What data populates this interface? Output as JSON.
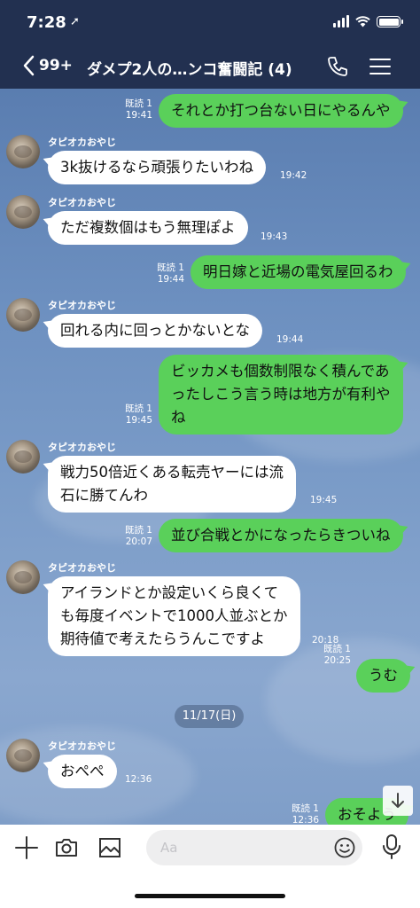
{
  "status_bar": {
    "time": "7:28",
    "location_icon": "location-arrow-icon"
  },
  "header": {
    "back_count": "99+",
    "title": "ダメプ2人の…ンコ奮闘記 (4)",
    "icons": [
      "back-chevron-icon",
      "phone-icon",
      "menu-icon"
    ]
  },
  "contact": {
    "name": "タピオカおやじ"
  },
  "messages": [
    {
      "dir": "out",
      "text": "それとか打つ台ない日にやるんや",
      "read": "既読 1",
      "time": "19:41"
    },
    {
      "dir": "in",
      "text": "3k抜けるなら頑張りたいわね",
      "time": "19:42"
    },
    {
      "dir": "in",
      "text": "ただ複数個はもう無理ぽよ",
      "time": "19:43"
    },
    {
      "dir": "out",
      "text": "明日嫁と近場の電気屋回るわ",
      "read": "既読 1",
      "time": "19:44"
    },
    {
      "dir": "in",
      "text": "回れる内に回っとかないとな",
      "time": "19:44"
    },
    {
      "dir": "out",
      "lines": [
        "ビッカメも個数制限なく積んであ",
        "ったしこう言う時は地方が有利や",
        "ね"
      ],
      "read": "既読 1",
      "time": "19:45"
    },
    {
      "dir": "in",
      "lines": [
        "戦力50倍近くある転売ヤーには流",
        "石に勝てんわ"
      ],
      "time": "19:45"
    },
    {
      "dir": "out",
      "text": "並び合戦とかになったらきついね",
      "read": "既読 1",
      "time": "20:07"
    },
    {
      "dir": "in",
      "lines": [
        "アイランドとか設定いくら良くて",
        "も毎度イベントで1000人並ぶとか",
        "期待値で考えたらうんこですよ"
      ],
      "time": "20:18"
    },
    {
      "dir": "out",
      "text": "うむ",
      "read": "既読 1",
      "time": "20:25"
    },
    {
      "dir": "in",
      "text": "おぺぺ",
      "time": "12:36"
    },
    {
      "dir": "out",
      "text": "おそよう",
      "read": "既読 1",
      "time": "12:36"
    }
  ],
  "date_separator": "11/17(日)",
  "input": {
    "placeholder": "Aa"
  },
  "colors": {
    "header_bg": "#223050",
    "outgoing_bubble": "#5ad05a",
    "incoming_bubble": "#ffffff"
  }
}
